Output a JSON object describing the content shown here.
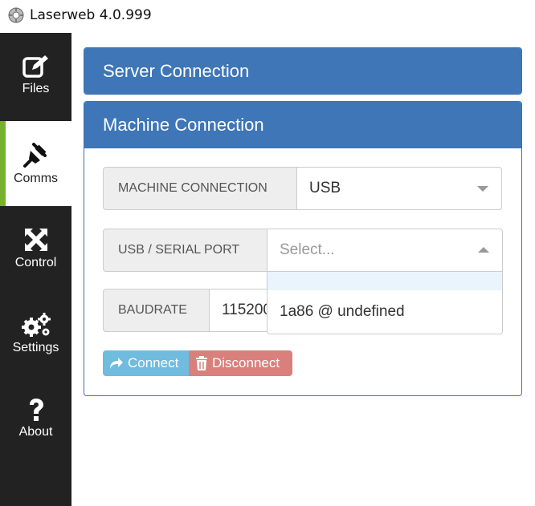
{
  "window": {
    "title": "Laserweb 4.0.999"
  },
  "sidebar": {
    "items": [
      {
        "label": "Files",
        "icon": "edit-icon"
      },
      {
        "label": "Comms",
        "icon": "plug-icon"
      },
      {
        "label": "Control",
        "icon": "arrows-icon"
      },
      {
        "label": "Settings",
        "icon": "gears-icon"
      },
      {
        "label": "About",
        "icon": "question-icon"
      }
    ],
    "active": "Comms"
  },
  "server_panel": {
    "title": "Server Connection"
  },
  "machine_panel": {
    "title": "Machine Connection",
    "machine_connection": {
      "label": "MACHINE CONNECTION",
      "value": "USB"
    },
    "serial_port": {
      "label": "USB / SERIAL PORT",
      "placeholder": "Select...",
      "options": [
        "",
        "1a86 @ undefined"
      ]
    },
    "baudrate": {
      "label": "BAUDRATE",
      "value": "115200"
    },
    "connect_label": "Connect",
    "disconnect_label": "Disconnect"
  },
  "colors": {
    "sidebar_bg": "#222222",
    "active_accent": "#77b22e",
    "panel_header": "#3e76b7",
    "connect_btn": "#6fbcde",
    "disconnect_btn": "#d9807c"
  }
}
